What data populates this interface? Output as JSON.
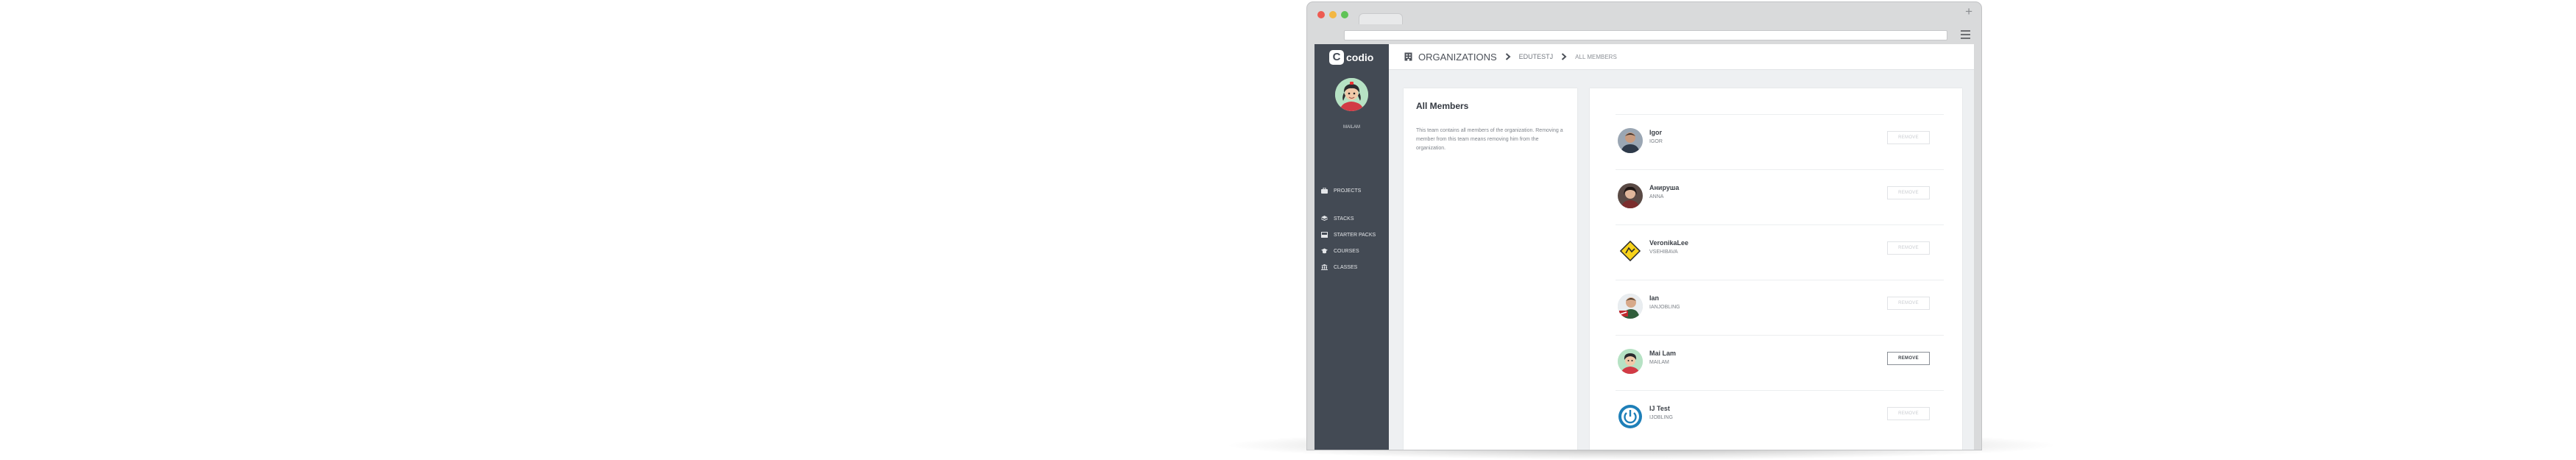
{
  "sidebar": {
    "logo_mark": "C",
    "logo_text": "codio",
    "user_name": "MAILAM",
    "nav": [
      {
        "label": "PROJECTS",
        "icon": "briefcase-icon"
      },
      {
        "label": "STACKS",
        "icon": "layers-icon"
      },
      {
        "label": "STARTER PACKS",
        "icon": "box-icon"
      },
      {
        "label": "COURSES",
        "icon": "graduation-cap-icon"
      },
      {
        "label": "CLASSES",
        "icon": "institution-icon"
      }
    ]
  },
  "breadcrumb": {
    "root": "ORGANIZATIONS",
    "org": "EDUTESTJ",
    "current": "ALL MEMBERS"
  },
  "panel": {
    "title": "All Members",
    "description": "This team contains all members of the organization. Removing a member from this team means removing him from the organization."
  },
  "members": [
    {
      "name": "Igor",
      "username": "IGOR",
      "remove": "REMOVE",
      "remove_enabled": false,
      "avatar": "avatar-photo"
    },
    {
      "name": "Анируша",
      "username": "ANNA",
      "remove": "REMOVE",
      "remove_enabled": false,
      "avatar": "avatar-photo"
    },
    {
      "name": "VeronikaLee",
      "username": "VSEHIBAVA",
      "remove": "REMOVE",
      "remove_enabled": false,
      "avatar": "warning-sign-avatar"
    },
    {
      "name": "Ian",
      "username": "IANJOBLING",
      "remove": "REMOVE",
      "remove_enabled": false,
      "avatar": "avatar-photo"
    },
    {
      "name": "Mai Lam",
      "username": "MAILAM",
      "remove": "REMOVE",
      "remove_enabled": true,
      "avatar": "cartoon-avatar"
    },
    {
      "name": "IJ Test",
      "username": "IJOBLING",
      "remove": "REMOVE",
      "remove_enabled": false,
      "avatar": "power-avatar"
    }
  ],
  "colors": {
    "sidebar_bg": "#434a54",
    "content_bg": "#eef0f2",
    "traffic_red": "#ee5b52",
    "traffic_yellow": "#f3b742",
    "traffic_green": "#5fc356"
  }
}
